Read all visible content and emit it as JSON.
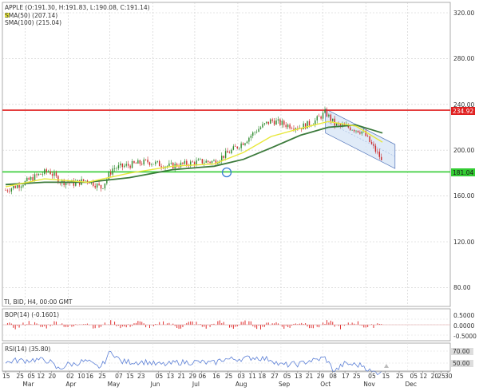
{
  "instrument": {
    "name": "APPLE",
    "ohlc_text": "(O:191.30, H:191.83, L:190.08, C:191.14)",
    "sma50": "SMA(50) (207.14)",
    "sma100": "SMA(100) (215.04)",
    "info_line": "TI, BID, H4, 00:00 GMT"
  },
  "indicators": {
    "bop_label": "BOP(14) (-0.1601)",
    "rsi_label": "RSI(14) (35.80)",
    "bop_ticks": [
      "0.5000",
      "0.0000",
      "-0.5000"
    ],
    "rsi_ticks": [
      "70.00",
      "50.00"
    ]
  },
  "price_axis": {
    "ticks": [
      "320.00",
      "280.00",
      "240.00",
      "200.00",
      "160.00",
      "120.00",
      "80.00"
    ],
    "resistance_label": "234.92",
    "support_label": "181.04"
  },
  "time_axis": {
    "day_labels": [
      "15",
      "25",
      "05",
      "12",
      "20",
      "02",
      "10",
      "16",
      "25",
      "07",
      "15",
      "23",
      "05",
      "13",
      "21",
      "29",
      "06",
      "16",
      "25",
      "03",
      "11",
      "18",
      "27",
      "05",
      "13",
      "21",
      "29",
      "08",
      "17",
      "25",
      "05",
      "15",
      "25",
      "05",
      "12",
      "20",
      "25",
      "30"
    ],
    "month_labels": [
      "Mar",
      "Apr",
      "May",
      "Jun",
      "Jul",
      "Aug",
      "Sep",
      "Oct",
      "Nov",
      "Dec"
    ]
  },
  "colors": {
    "up_candle": "#2e8b2e",
    "down_candle": "#cc2a2a",
    "sma50": "#e8e83a",
    "sma100": "#3b7a3b",
    "resistance": "#e02020",
    "support": "#33cc33",
    "channel_fill": "#d6e4f5",
    "channel_edge": "#5577bb",
    "bop": "#e03030",
    "rsi": "#5b7fd6",
    "marker": "#3a7bd5"
  },
  "chart_data": {
    "type": "candlestick",
    "y_range": [
      60,
      330
    ],
    "resistance": 234.92,
    "support": 181.04,
    "price_path": [
      {
        "x": "Feb 15",
        "y": 165
      },
      {
        "x": "Mar 01",
        "y": 172
      },
      {
        "x": "Mar 10",
        "y": 178
      },
      {
        "x": "Mar 18",
        "y": 182
      },
      {
        "x": "Mar 26",
        "y": 173
      },
      {
        "x": "Apr 05",
        "y": 171
      },
      {
        "x": "Apr 15",
        "y": 174
      },
      {
        "x": "Apr 25",
        "y": 167
      },
      {
        "x": "May 03",
        "y": 184
      },
      {
        "x": "May 15",
        "y": 187
      },
      {
        "x": "May 28",
        "y": 190
      },
      {
        "x": "Jun 12",
        "y": 186
      },
      {
        "x": "Jun 25",
        "y": 188
      },
      {
        "x": "Jul 05",
        "y": 190
      },
      {
        "x": "Jul 15",
        "y": 190
      },
      {
        "x": "Jul 28",
        "y": 200
      },
      {
        "x": "Aug 06",
        "y": 208
      },
      {
        "x": "Aug 15",
        "y": 218
      },
      {
        "x": "Aug 25",
        "y": 226
      },
      {
        "x": "Sep 05",
        "y": 222
      },
      {
        "x": "Sep 15",
        "y": 220
      },
      {
        "x": "Sep 25",
        "y": 225
      },
      {
        "x": "Oct 03",
        "y": 233
      },
      {
        "x": "Oct 10",
        "y": 222
      },
      {
        "x": "Oct 20",
        "y": 220
      },
      {
        "x": "Oct 30",
        "y": 216
      },
      {
        "x": "Nov 05",
        "y": 205
      },
      {
        "x": "Nov 10",
        "y": 196
      },
      {
        "x": "Nov 13",
        "y": 191
      }
    ],
    "sma50": [
      {
        "x": "Feb 15",
        "y": 168
      },
      {
        "x": "Mar 15",
        "y": 175
      },
      {
        "x": "Apr 15",
        "y": 172
      },
      {
        "x": "May 15",
        "y": 180
      },
      {
        "x": "Jun 15",
        "y": 186
      },
      {
        "x": "Jul 15",
        "y": 188
      },
      {
        "x": "Aug 05",
        "y": 198
      },
      {
        "x": "Aug 25",
        "y": 212
      },
      {
        "x": "Sep 15",
        "y": 219
      },
      {
        "x": "Oct 05",
        "y": 225
      },
      {
        "x": "Oct 25",
        "y": 221
      },
      {
        "x": "Nov 13",
        "y": 207
      }
    ],
    "sma100": [
      {
        "x": "Feb 15",
        "y": 170
      },
      {
        "x": "Mar 15",
        "y": 172
      },
      {
        "x": "Apr 15",
        "y": 172
      },
      {
        "x": "May 15",
        "y": 176
      },
      {
        "x": "Jun 15",
        "y": 183
      },
      {
        "x": "Jul 15",
        "y": 186
      },
      {
        "x": "Aug 05",
        "y": 192
      },
      {
        "x": "Aug 25",
        "y": 202
      },
      {
        "x": "Sep 15",
        "y": 213
      },
      {
        "x": "Oct 05",
        "y": 220
      },
      {
        "x": "Oct 25",
        "y": 222
      },
      {
        "x": "Nov 13",
        "y": 215
      }
    ],
    "channel": {
      "upper": [
        {
          "x": "Oct 03",
          "y": 236
        },
        {
          "x": "Nov 22",
          "y": 205
        }
      ],
      "lower": [
        {
          "x": "Oct 03",
          "y": 215
        },
        {
          "x": "Nov 22",
          "y": 184
        }
      ]
    }
  }
}
